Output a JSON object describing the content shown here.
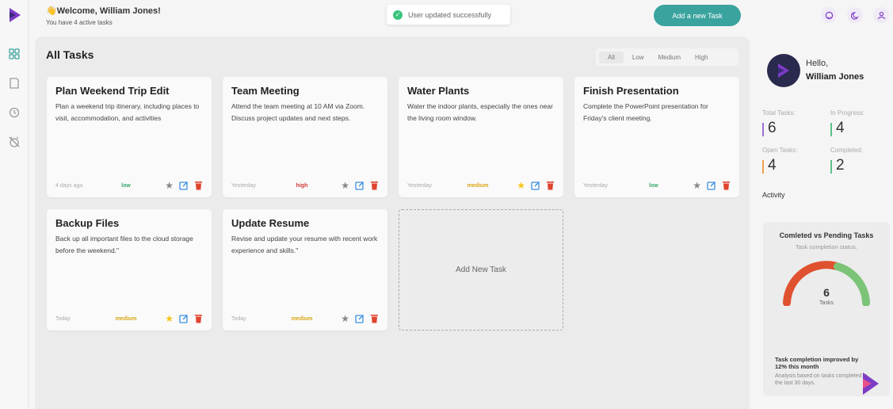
{
  "header": {
    "welcome": "👋Welcome, William Jones!",
    "subtitle": "You have 4 active tasks",
    "toast": "User updated successfully",
    "add_task_button": "Add a new Task",
    "icons": [
      "github-icon",
      "moon-icon",
      "user-icon"
    ]
  },
  "sidebar": {
    "icons": [
      "grid-icon",
      "notes-icon",
      "clock-icon",
      "alarm-off-icon"
    ]
  },
  "main": {
    "title": "All Tasks",
    "filters": [
      "All",
      "Low",
      "Medium",
      "High"
    ],
    "active_filter": "All",
    "tasks": [
      {
        "title": "Plan Weekend Trip Edit",
        "description": "Plan a weekend trip itinerary, including places to visit, accommodation, and activities",
        "date": "4 days ago",
        "priority": "low",
        "starred": false
      },
      {
        "title": "Team Meeting",
        "description": "Attend the team meeting at 10 AM via Zoom. Discuss project updates and next steps.",
        "date": "Yesterday",
        "priority": "high",
        "starred": false
      },
      {
        "title": "Water Plants",
        "description": "Water the indoor plants, especially the ones near the living room window.",
        "date": "Yesterday",
        "priority": "medium",
        "starred": true
      },
      {
        "title": "Finish Presentation",
        "description": "Complete the PowerPoint presentation for Friday's client meeting.",
        "date": "Yesterday",
        "priority": "low",
        "starred": false
      },
      {
        "title": "Backup Files",
        "description": "Back up all important files to the cloud storage before the weekend.\"",
        "date": "Today",
        "priority": "medium",
        "starred": true
      },
      {
        "title": "Update Resume",
        "description": "Revise and update your resume with recent work experience and skills.\"",
        "date": "Today",
        "priority": "medium",
        "starred": false
      }
    ],
    "add_new_task": "Add New Task"
  },
  "profile": {
    "hello": "Hello,",
    "name": "William Jones",
    "stats": {
      "total_label": "Total Tasks:",
      "total_value": "6",
      "progress_label": "In Progress:",
      "progress_value": "4",
      "open_label": "Open Tasks:",
      "open_value": "4",
      "completed_label": "Completed:",
      "completed_value": "2"
    },
    "activity": "Activity",
    "gauge": {
      "title": "Comleted vs Pending Tasks",
      "subtitle": "Task completion status.",
      "value": "6",
      "value_label": "Tasks",
      "note": "Task completion improved by 12% this month",
      "footnote": "Analysis based on tasks completed in the last 30 days."
    }
  },
  "colors": {
    "accent": "#3aa39e",
    "brand": "#7d3cc6",
    "low": "#3aa76d",
    "medium": "#d9a414",
    "high": "#d23a3a",
    "gauge_red": "#e0512f",
    "gauge_green": "#7cc478"
  }
}
